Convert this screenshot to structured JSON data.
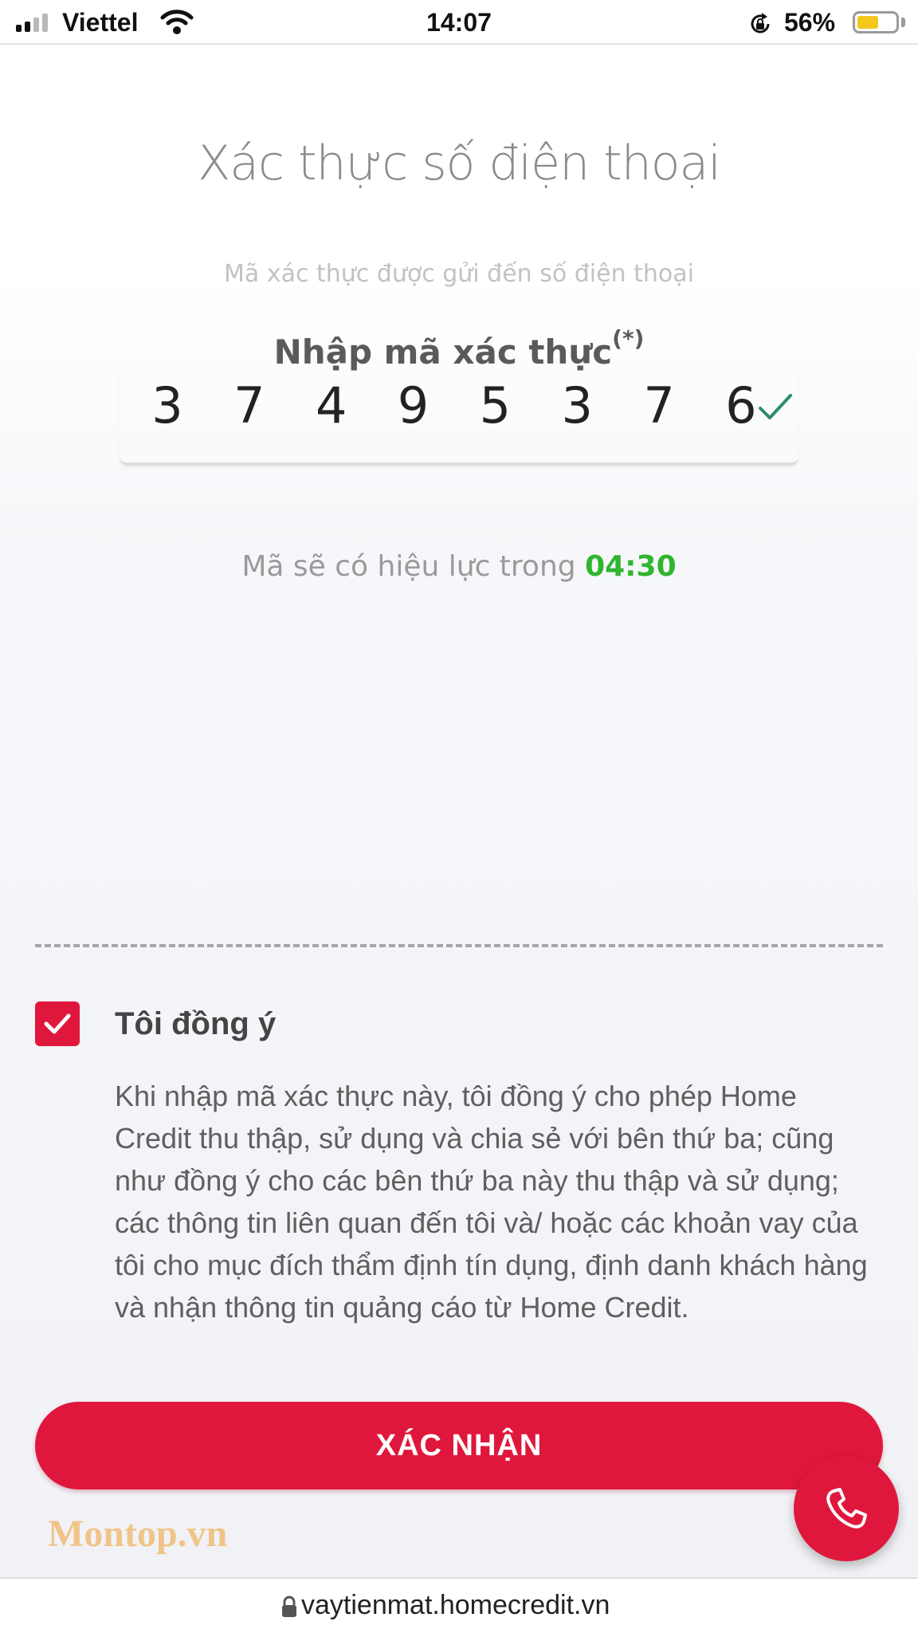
{
  "status_bar": {
    "carrier": "Viettel",
    "time": "14:07",
    "battery_percent": "56%",
    "battery_level": 0.56,
    "icons": [
      "signal-icon",
      "wifi-icon",
      "rotation-lock-icon",
      "battery-icon"
    ]
  },
  "header": {
    "title": "Xác thực số điện thoại",
    "subtitle": "Mã xác thực được gửi đến số điện thoại"
  },
  "verification": {
    "label": "Nhập mã xác thực",
    "required_marker": "(*)",
    "digits": [
      "3",
      "7",
      "4",
      "9",
      "5",
      "3",
      "7",
      "6"
    ],
    "validity_text": "Mã sẽ có hiệu lực trong ",
    "timer": "04:30"
  },
  "agreement": {
    "checked": true,
    "label": "Tôi đồng ý",
    "text": "Khi nhập mã xác thực này, tôi đồng ý cho phép Home Credit thu thập, sử dụng và chia sẻ với bên thứ ba; cũng như đồng ý cho các bên thứ ba này thu thập và sử dụng; các thông tin liên quan đến tôi và/ hoặc các khoản vay của tôi cho mục đích thẩm định tín dụng, định danh khách hàng và nhận thông tin quảng cáo từ Home Credit."
  },
  "actions": {
    "confirm_label": "XÁC NHẬN"
  },
  "watermark": "Montop.vn",
  "browser": {
    "url": "vaytienmat.homecredit.vn"
  },
  "colors": {
    "accent": "#e0173c",
    "timer": "#2fb52e",
    "battery": "#f2c81f"
  }
}
